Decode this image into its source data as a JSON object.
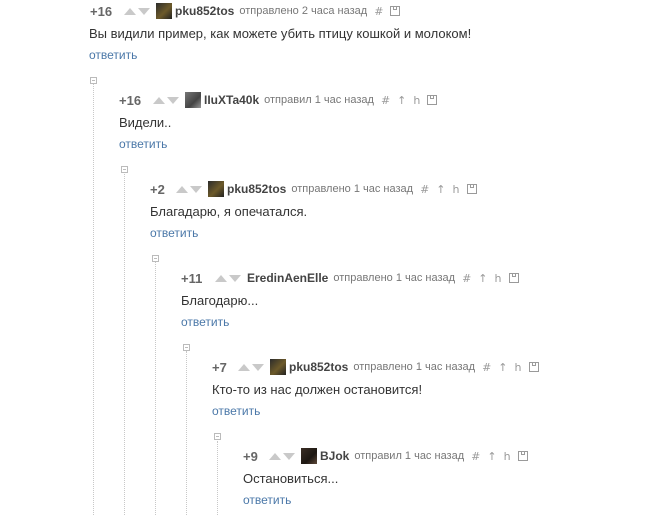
{
  "comments": [
    {
      "rating": "+16",
      "user": "pku852tos",
      "meta": "отправлено 2 часа назад",
      "text": "Вы видили пример, как можете убить птицу кошкой и молоком!",
      "reply": "ответить"
    },
    {
      "rating": "+16",
      "user": "IIuXTa40k",
      "meta": "отправил 1 час назад",
      "text": "Видели..",
      "reply": "ответить"
    },
    {
      "rating": "+2",
      "user": "pku852tos",
      "meta": "отправлено 1 час назад",
      "text": "Благадарю, я опечатался.",
      "reply": "ответить"
    },
    {
      "rating": "+11",
      "user": "EredinAenElle",
      "meta": "отправлено 1 час назад",
      "text": "Благодарю...",
      "reply": "ответить"
    },
    {
      "rating": "+7",
      "user": "pku852tos",
      "meta": "отправлено 1 час назад",
      "text": "Кто-то из нас должен остановится!",
      "reply": "ответить"
    },
    {
      "rating": "+9",
      "user": "BJok",
      "meta": "отправил 1 час назад",
      "text": "Остановиться...",
      "reply": "ответить"
    }
  ],
  "icons": {
    "hash": "#",
    "up": "↑",
    "branch": "h"
  }
}
